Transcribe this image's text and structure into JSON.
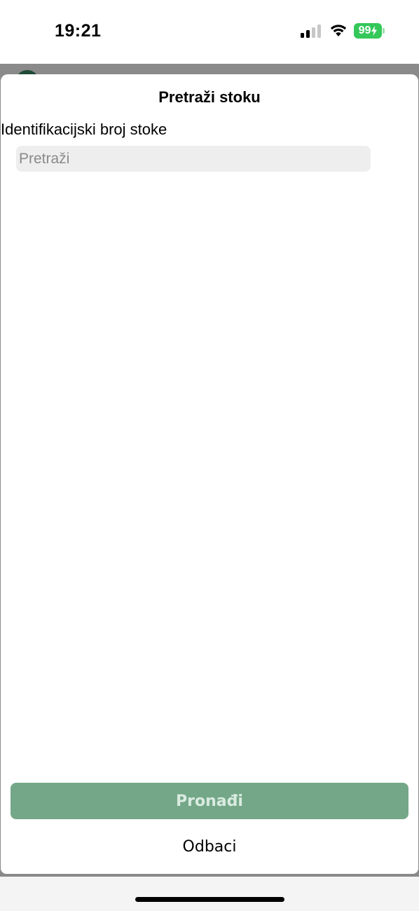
{
  "status_bar": {
    "time": "19:21",
    "battery_level": "99",
    "icons": [
      "cellular-signal-icon",
      "wifi-icon",
      "battery-charging-icon"
    ],
    "battery_color": "#34c759"
  },
  "sheet": {
    "title": "Pretraži stoku",
    "field_label": "Identifikacijski broj stoke",
    "search": {
      "value": "",
      "placeholder": "Pretraži"
    },
    "find_label": "Pronađi",
    "dismiss_label": "Odbaci"
  },
  "colors": {
    "primary_button": "#74a788",
    "primary_button_text": "#d9ebe0",
    "input_background": "#eeeeee"
  }
}
